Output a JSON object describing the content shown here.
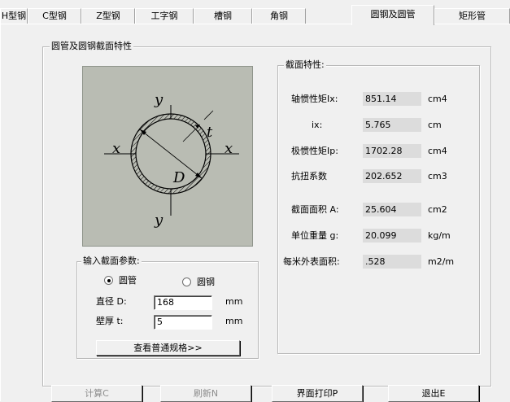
{
  "tabs": [
    {
      "label": "H型钢"
    },
    {
      "label": "C型钢"
    },
    {
      "label": "Z型钢"
    },
    {
      "label": "工字钢"
    },
    {
      "label": "槽钢"
    },
    {
      "label": "角钢"
    },
    {
      "label": "圆钢及圆管",
      "active": true
    },
    {
      "label": "矩形管"
    }
  ],
  "main_group": {
    "title": "圆管及圆钢截面特性"
  },
  "figure": {
    "x": "x",
    "y": "y",
    "t": "t",
    "D": "D"
  },
  "props_group": {
    "title": "截面特性:",
    "rows": [
      {
        "label": "轴惯性矩Ix:",
        "value": "851.14",
        "unit": "cm4"
      },
      {
        "label": "ix:",
        "value": "5.765",
        "unit": "cm"
      },
      {
        "label": "极惯性矩Ip:",
        "value": "1702.28",
        "unit": "cm4"
      },
      {
        "label": "抗扭系数",
        "value": "202.652",
        "unit": "cm3"
      },
      {
        "label": "截面面积 A:",
        "value": "25.604",
        "unit": "cm2"
      },
      {
        "label": "单位重量 g:",
        "value": "20.099",
        "unit": "kg/m"
      },
      {
        "label": "每米外表面积:",
        "value": ".528",
        "unit": "m2/m"
      }
    ]
  },
  "input_group": {
    "title": "输入截面参数:",
    "radio_pipe": "圆管",
    "radio_bar": "圆钢",
    "selected": "圆管",
    "diameter_label": "直径 D:",
    "diameter_value": "168",
    "diameter_unit": "mm",
    "thickness_label": "壁厚 t:",
    "thickness_value": "5",
    "thickness_unit": "mm",
    "spec_button": "查看普通规格>>"
  },
  "buttons": {
    "calc": "计算C",
    "calc_key": "C",
    "refresh": "刷新N",
    "refresh_key": "N",
    "print": "界面打印P",
    "print_key": "P",
    "exit": "退出E",
    "exit_key": "E"
  }
}
